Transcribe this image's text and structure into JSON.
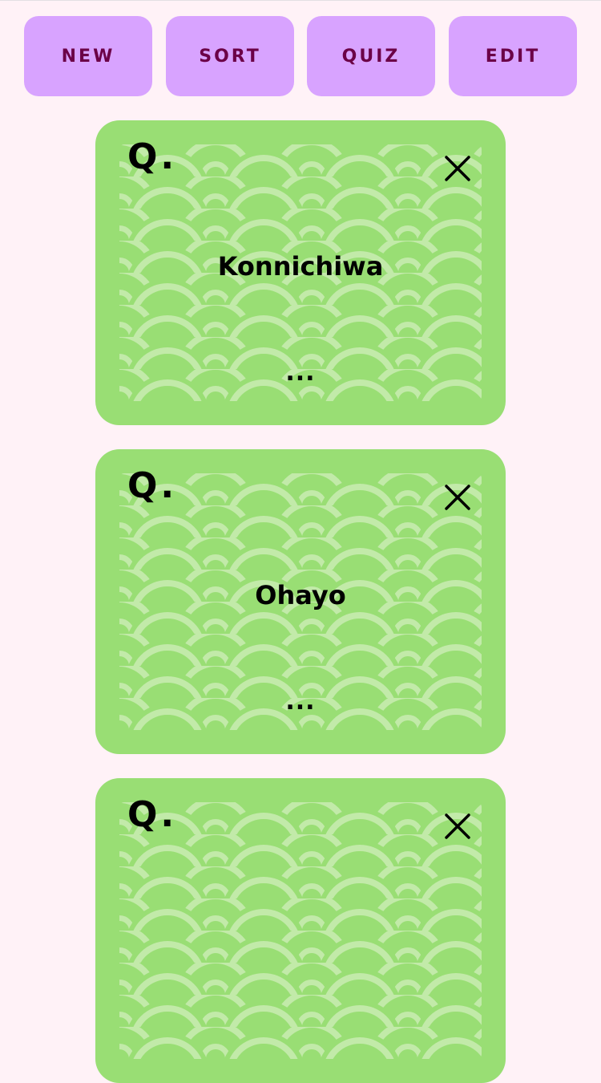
{
  "toolbar": {
    "new_label": "NEW",
    "sort_label": "SORT",
    "quiz_label": "QUIZ",
    "edit_label": "EDIT"
  },
  "cards": [
    {
      "prefix": "Q.",
      "word": "Konnichiwa",
      "more": "...",
      "close_icon": "close-icon"
    },
    {
      "prefix": "Q.",
      "word": "Ohayo",
      "more": "...",
      "close_icon": "close-icon"
    },
    {
      "prefix": "Q.",
      "word": "",
      "more": "",
      "close_icon": "close-icon"
    }
  ],
  "colors": {
    "background": "#fff2f7",
    "button_fill": "#d8a3ff",
    "button_text": "#6b0047",
    "card_fill": "#99de74",
    "card_pattern_light": "#c2eaa9"
  }
}
